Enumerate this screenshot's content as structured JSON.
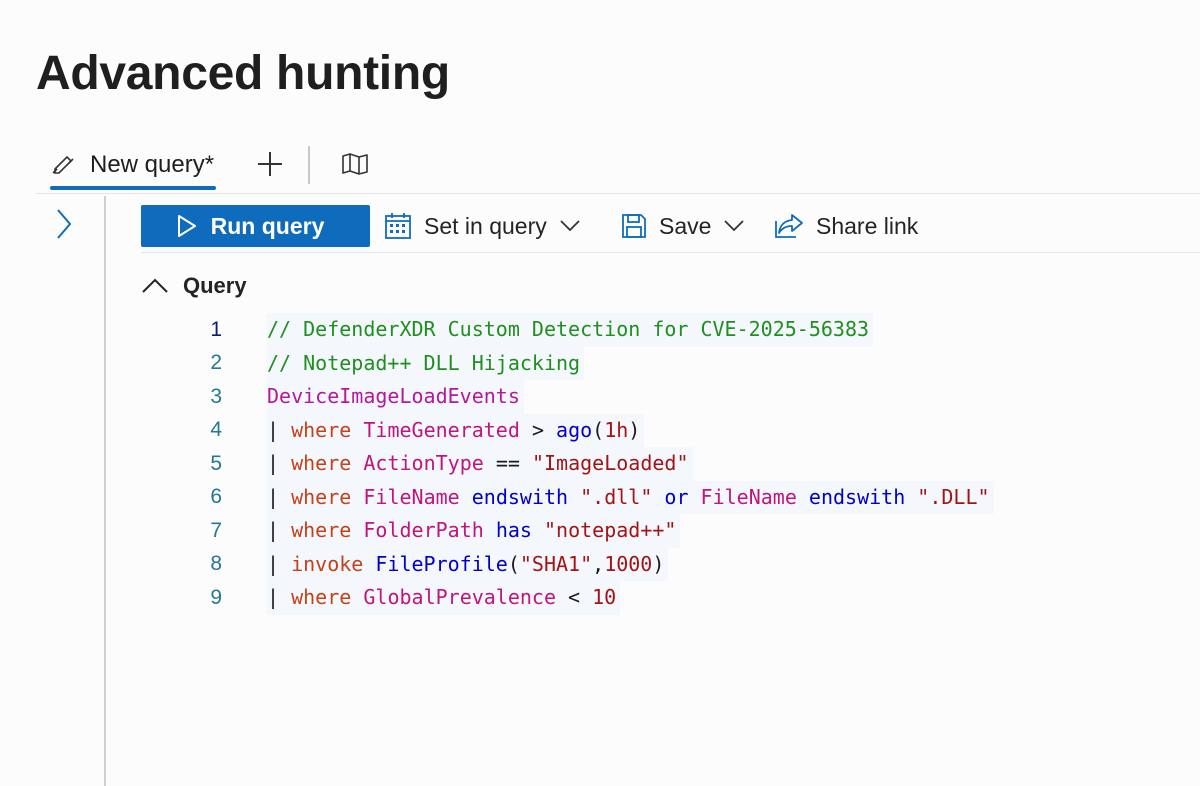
{
  "page": {
    "title": "Advanced hunting"
  },
  "tabs": {
    "active_label": "New query*"
  },
  "toolbar": {
    "run_label": "Run query",
    "set_in_query_label": "Set in query",
    "save_label": "Save",
    "share_label": "Share link"
  },
  "query_section": {
    "label": "Query"
  },
  "editor": {
    "lines": [
      {
        "n": "1",
        "tokens": [
          {
            "t": "// DefenderXDR Custom Detection for CVE-2025-56383",
            "c": "comment"
          }
        ]
      },
      {
        "n": "2",
        "tokens": [
          {
            "t": "// Notepad++ DLL Hijacking",
            "c": "comment"
          }
        ]
      },
      {
        "n": "3",
        "tokens": [
          {
            "t": "DeviceImageLoadEvents",
            "c": "table"
          }
        ]
      },
      {
        "n": "4",
        "tokens": [
          {
            "t": "| ",
            "c": "pipe"
          },
          {
            "t": "where",
            "c": "kw"
          },
          {
            "t": " ",
            "c": "plain"
          },
          {
            "t": "TimeGenerated",
            "c": "field"
          },
          {
            "t": " > ",
            "c": "plain"
          },
          {
            "t": "ago",
            "c": "fn"
          },
          {
            "t": "(",
            "c": "plain"
          },
          {
            "t": "1h",
            "c": "num"
          },
          {
            "t": ")",
            "c": "plain"
          }
        ]
      },
      {
        "n": "5",
        "tokens": [
          {
            "t": "| ",
            "c": "pipe"
          },
          {
            "t": "where",
            "c": "kw"
          },
          {
            "t": " ",
            "c": "plain"
          },
          {
            "t": "ActionType",
            "c": "field"
          },
          {
            "t": " == ",
            "c": "plain"
          },
          {
            "t": "\"ImageLoaded\"",
            "c": "str"
          }
        ]
      },
      {
        "n": "6",
        "tokens": [
          {
            "t": "| ",
            "c": "pipe"
          },
          {
            "t": "where",
            "c": "kw"
          },
          {
            "t": " ",
            "c": "plain"
          },
          {
            "t": "FileName",
            "c": "field"
          },
          {
            "t": " ",
            "c": "plain"
          },
          {
            "t": "endswith",
            "c": "op"
          },
          {
            "t": " ",
            "c": "plain"
          },
          {
            "t": "\".dll\"",
            "c": "str"
          },
          {
            "t": " ",
            "c": "plain"
          },
          {
            "t": "or",
            "c": "op"
          },
          {
            "t": " ",
            "c": "plain"
          },
          {
            "t": "FileName",
            "c": "field"
          },
          {
            "t": " ",
            "c": "plain"
          },
          {
            "t": "endswith",
            "c": "op"
          },
          {
            "t": " ",
            "c": "plain"
          },
          {
            "t": "\".DLL\"",
            "c": "str"
          }
        ]
      },
      {
        "n": "7",
        "tokens": [
          {
            "t": "| ",
            "c": "pipe"
          },
          {
            "t": "where",
            "c": "kw"
          },
          {
            "t": " ",
            "c": "plain"
          },
          {
            "t": "FolderPath",
            "c": "field"
          },
          {
            "t": " ",
            "c": "plain"
          },
          {
            "t": "has",
            "c": "op"
          },
          {
            "t": " ",
            "c": "plain"
          },
          {
            "t": "\"notepad++\"",
            "c": "str"
          }
        ]
      },
      {
        "n": "8",
        "tokens": [
          {
            "t": "| ",
            "c": "pipe"
          },
          {
            "t": "invoke",
            "c": "kw"
          },
          {
            "t": " ",
            "c": "plain"
          },
          {
            "t": "FileProfile",
            "c": "fn"
          },
          {
            "t": "(",
            "c": "plain"
          },
          {
            "t": "\"SHA1\"",
            "c": "str"
          },
          {
            "t": ",",
            "c": "plain"
          },
          {
            "t": "1000",
            "c": "num"
          },
          {
            "t": ")",
            "c": "plain"
          }
        ]
      },
      {
        "n": "9",
        "tokens": [
          {
            "t": "| ",
            "c": "pipe"
          },
          {
            "t": "where",
            "c": "kw"
          },
          {
            "t": " ",
            "c": "plain"
          },
          {
            "t": "GlobalPrevalence",
            "c": "field"
          },
          {
            "t": " < ",
            "c": "plain"
          },
          {
            "t": "10",
            "c": "num"
          }
        ]
      }
    ]
  },
  "colors": {
    "accent": "#0f6cbd"
  },
  "icons": {
    "tab": "edit-query-icon",
    "add": "plus-icon",
    "schema": "map-icon",
    "rail": "chevron-right-icon",
    "run": "play-icon",
    "set_in_query": "calendar-icon",
    "save": "save-icon",
    "share": "share-icon",
    "collapse": "chevron-up-icon"
  }
}
